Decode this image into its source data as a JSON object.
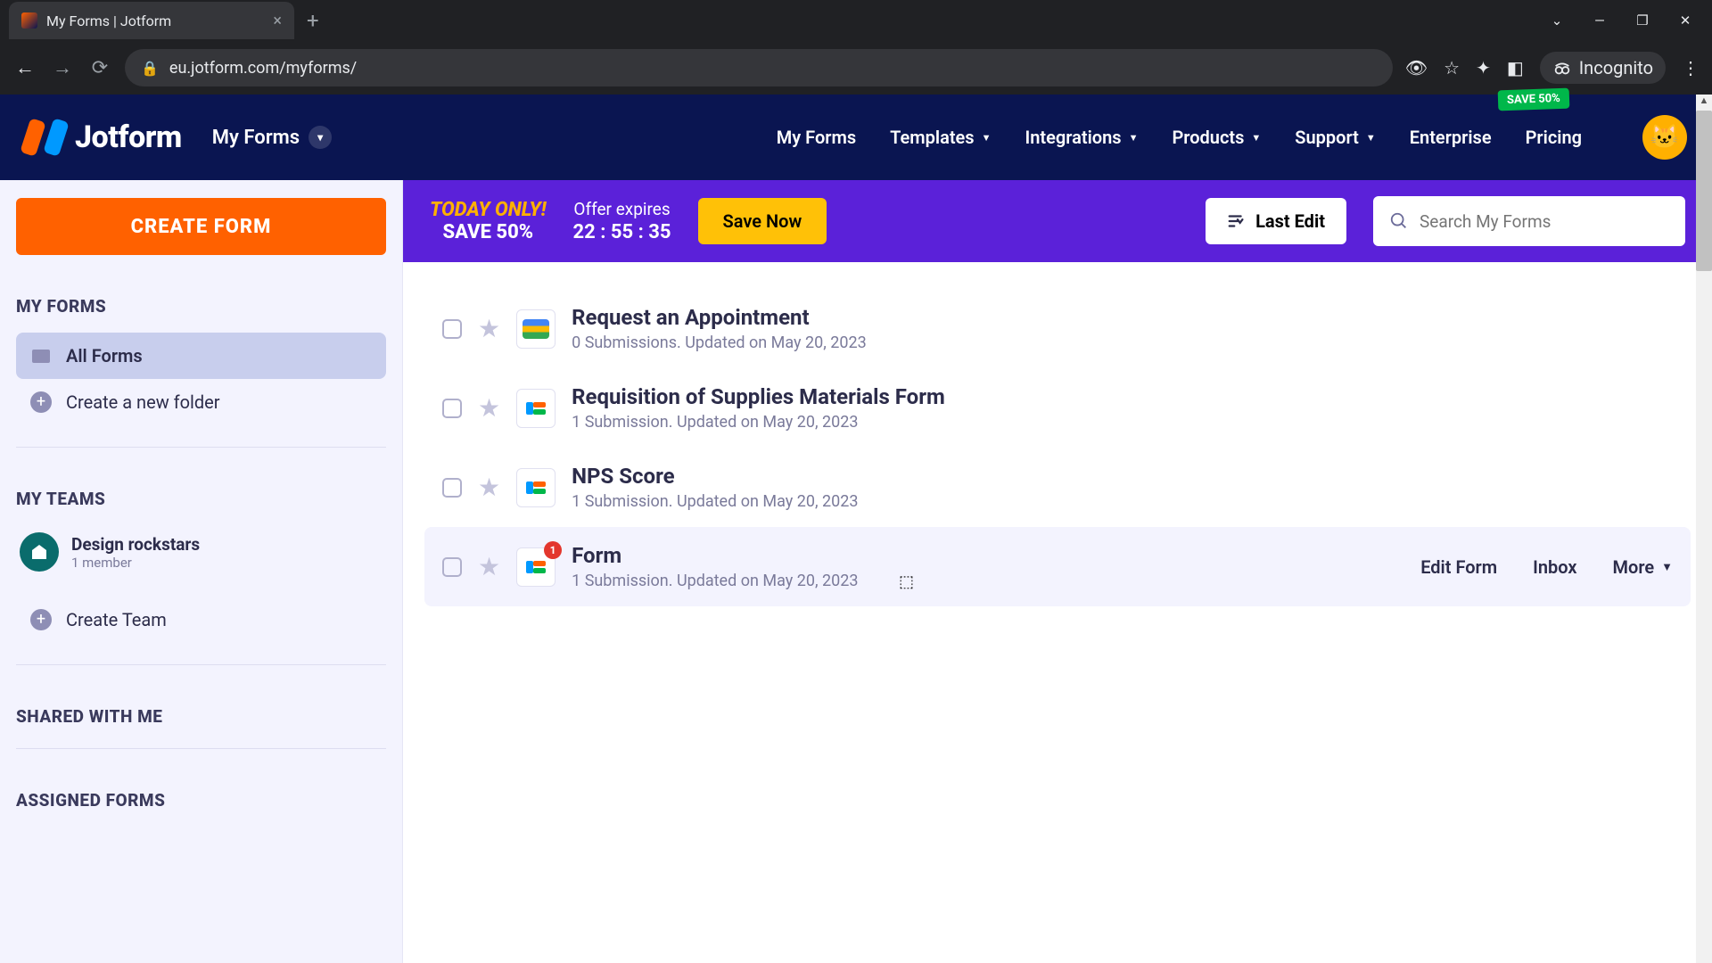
{
  "browser": {
    "tab_title": "My Forms | Jotform",
    "url": "eu.jotform.com/myforms/",
    "incognito_label": "Incognito"
  },
  "header": {
    "brand": "Jotform",
    "context_label": "My Forms",
    "nav": {
      "my_forms": "My Forms",
      "templates": "Templates",
      "integrations": "Integrations",
      "products": "Products",
      "support": "Support",
      "enterprise": "Enterprise",
      "pricing": "Pricing"
    },
    "save_badge": "SAVE 50%"
  },
  "sidebar": {
    "create_label": "CREATE FORM",
    "sections": {
      "my_forms": "MY FORMS",
      "my_teams": "MY TEAMS",
      "shared": "SHARED WITH ME",
      "assigned": "ASSIGNED FORMS"
    },
    "all_forms": "All Forms",
    "new_folder": "Create a new folder",
    "team_name": "Design rockstars",
    "team_meta": "1 member",
    "create_team": "Create Team"
  },
  "promo": {
    "line1": "TODAY ONLY!",
    "line2": "SAVE 50%",
    "expire_label": "Offer expires",
    "timer": "22 : 55 : 35",
    "save_now": "Save Now",
    "last_edit": "Last Edit",
    "search_placeholder": "Search My Forms"
  },
  "forms": [
    {
      "title": "Request an Appointment",
      "meta": "0 Submissions. Updated on May 20, 2023",
      "badge": false
    },
    {
      "title": "Requisition of Supplies Materials Form",
      "meta": "1 Submission. Updated on May 20, 2023",
      "badge": false
    },
    {
      "title": "NPS Score",
      "meta": "1 Submission. Updated on May 20, 2023",
      "badge": false
    },
    {
      "title": "Form",
      "meta": "1 Submission. Updated on May 20, 2023",
      "badge": true
    }
  ],
  "row_actions": {
    "edit": "Edit Form",
    "inbox": "Inbox",
    "more": "More"
  },
  "badge_value": "1"
}
